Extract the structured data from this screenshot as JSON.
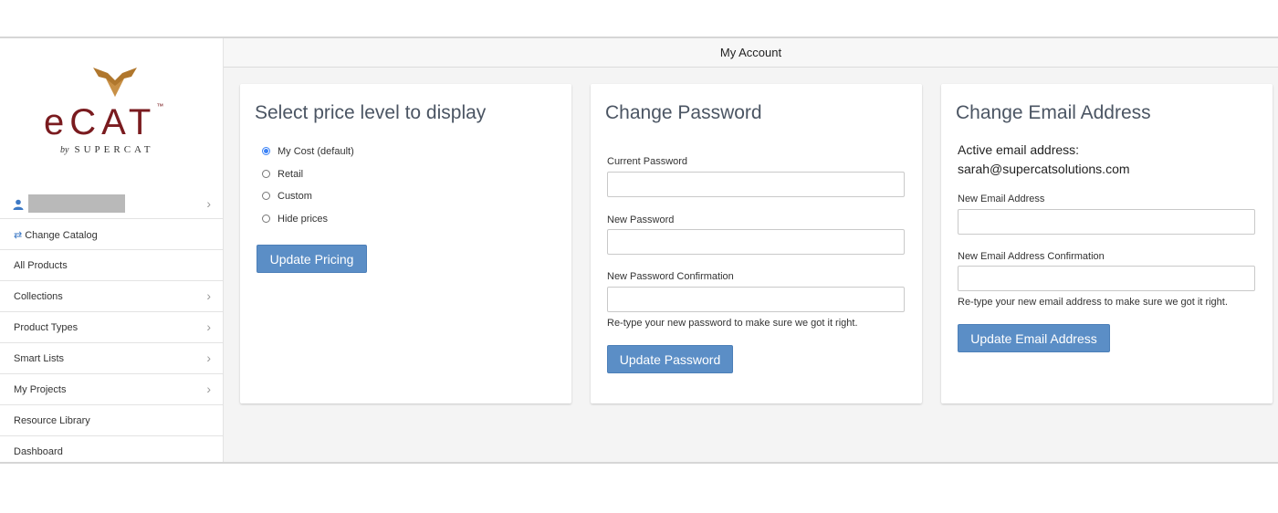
{
  "brand": {
    "name": "eCAT",
    "tm": "™",
    "by": "by",
    "company": "SUPERCAT"
  },
  "sidebar": {
    "items": [
      {
        "label": "Change Catalog",
        "icon": "swap-icon",
        "chevron": false
      },
      {
        "label": "All Products",
        "chevron": false
      },
      {
        "label": "Collections",
        "chevron": true
      },
      {
        "label": "Product Types",
        "chevron": true
      },
      {
        "label": "Smart Lists",
        "chevron": true
      },
      {
        "label": "My Projects",
        "chevron": true
      },
      {
        "label": "Resource Library",
        "chevron": false
      },
      {
        "label": "Dashboard",
        "chevron": false
      }
    ]
  },
  "header": {
    "title": "My Account"
  },
  "pricing": {
    "title": "Select price level to display",
    "options": [
      "My Cost (default)",
      "Retail",
      "Custom",
      "Hide prices"
    ],
    "selected": "My Cost (default)",
    "button": "Update Pricing"
  },
  "password": {
    "title": "Change Password",
    "current_label": "Current Password",
    "new_label": "New Password",
    "confirm_label": "New Password Confirmation",
    "hint": "Re-type your new password to make sure we got it right.",
    "button": "Update Password"
  },
  "email": {
    "title": "Change Email Address",
    "active_label": "Active email address:",
    "active_value": "sarah@supercatsolutions.com",
    "new_label": "New Email Address",
    "confirm_label": "New Email Address Confirmation",
    "hint": "Re-type your new email address to make sure we got it right.",
    "button": "Update Email Address"
  },
  "colors": {
    "brand": "#7a1b1f",
    "accent": "#5b8ec6",
    "logo_gold": "#b0772d"
  }
}
